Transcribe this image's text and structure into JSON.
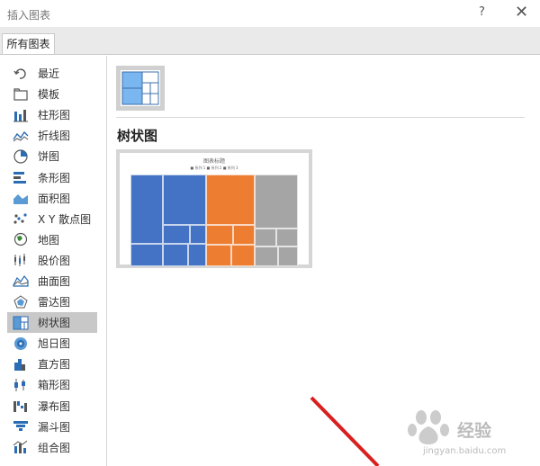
{
  "window": {
    "title": "插入图表",
    "help": "?",
    "close": "✕"
  },
  "tab": {
    "label": "所有图表"
  },
  "sidebar": {
    "selected_index": 12,
    "items": [
      {
        "label": "最近",
        "icon": "recent-icon"
      },
      {
        "label": "模板",
        "icon": "template-folder-icon"
      },
      {
        "label": "柱形图",
        "icon": "column-chart-icon"
      },
      {
        "label": "折线图",
        "icon": "line-chart-icon"
      },
      {
        "label": "饼图",
        "icon": "pie-chart-icon"
      },
      {
        "label": "条形图",
        "icon": "bar-chart-icon"
      },
      {
        "label": "面积图",
        "icon": "area-chart-icon"
      },
      {
        "label": "X Y 散点图",
        "icon": "scatter-chart-icon"
      },
      {
        "label": "地图",
        "icon": "map-chart-icon"
      },
      {
        "label": "股价图",
        "icon": "stock-chart-icon"
      },
      {
        "label": "曲面图",
        "icon": "surface-chart-icon"
      },
      {
        "label": "雷达图",
        "icon": "radar-chart-icon"
      },
      {
        "label": "树状图",
        "icon": "treemap-chart-icon"
      },
      {
        "label": "旭日图",
        "icon": "sunburst-chart-icon"
      },
      {
        "label": "直方图",
        "icon": "histogram-chart-icon"
      },
      {
        "label": "箱形图",
        "icon": "box-whisker-chart-icon"
      },
      {
        "label": "瀑布图",
        "icon": "waterfall-chart-icon"
      },
      {
        "label": "漏斗图",
        "icon": "funnel-chart-icon"
      },
      {
        "label": "组合图",
        "icon": "combo-chart-icon"
      }
    ]
  },
  "main": {
    "chart_type_heading": "树状图",
    "preview": {
      "title": "图表标题",
      "legend": "■ 系列 1  ■ 系列 2  ■ 系列 3"
    }
  },
  "colors": {
    "blue": "#4472c4",
    "orange": "#ed7d31",
    "gray": "#a5a5a5",
    "selected": "#c8c8c8",
    "accent_light": "#7ab6f0"
  },
  "watermark": {
    "text": "经验",
    "url": "jingyan.baidu.com",
    "brand": "Baidu"
  }
}
